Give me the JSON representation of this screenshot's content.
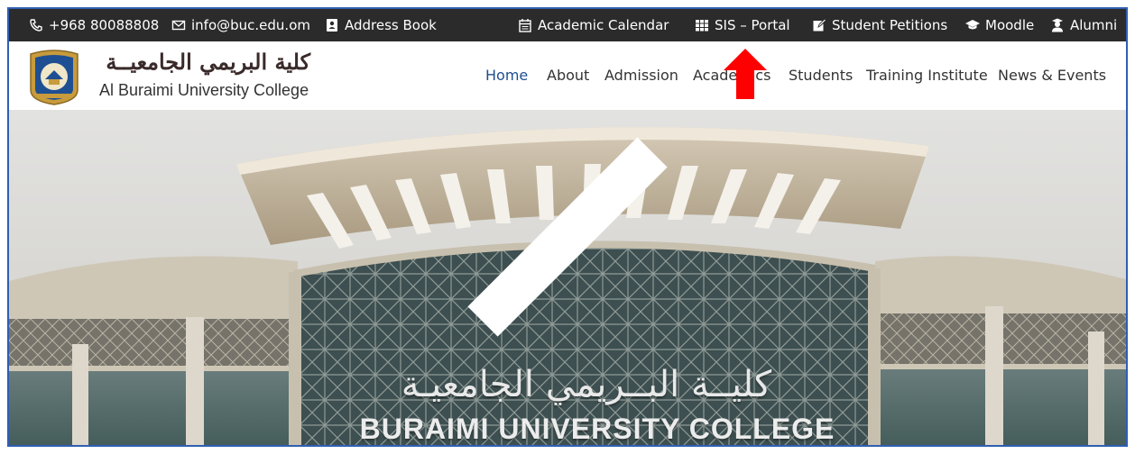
{
  "topbar": {
    "phone": "+968 80088808",
    "email": "info@buc.edu.om",
    "address_book": "Address Book",
    "academic_calendar": "Academic Calendar",
    "sis_portal": "SIS – Portal",
    "student_petitions": "Student Petitions",
    "moodle": "Moodle",
    "alumni": "Alumni"
  },
  "brand": {
    "name_ar": "كلية البريمي الجامعيــة",
    "name_en": "Al Buraimi University College"
  },
  "nav": {
    "items": [
      "Home",
      "About",
      "Admission",
      "Academics",
      "Students",
      "Training Institute",
      "News & Events"
    ],
    "active": "Home"
  },
  "hero": {
    "building_sign_ar": "كليــة البــريمي الجامعيـة",
    "building_sign_en": "BURAIMI UNIVERSITY COLLEGE"
  },
  "colors": {
    "topbar_bg": "#2b2b2b",
    "nav_active": "#1f4f8f",
    "annotation_arrow": "#ff0000",
    "frame_border": "#2f5fb3"
  },
  "icons": {
    "phone": "phone-icon",
    "email": "envelope-icon",
    "address_book": "address-book-icon",
    "academic_calendar": "calendar-icon",
    "sis_portal": "grid-icon",
    "student_petitions": "edit-icon",
    "moodle": "graduation-cap-icon",
    "alumni": "user-graduate-icon"
  }
}
